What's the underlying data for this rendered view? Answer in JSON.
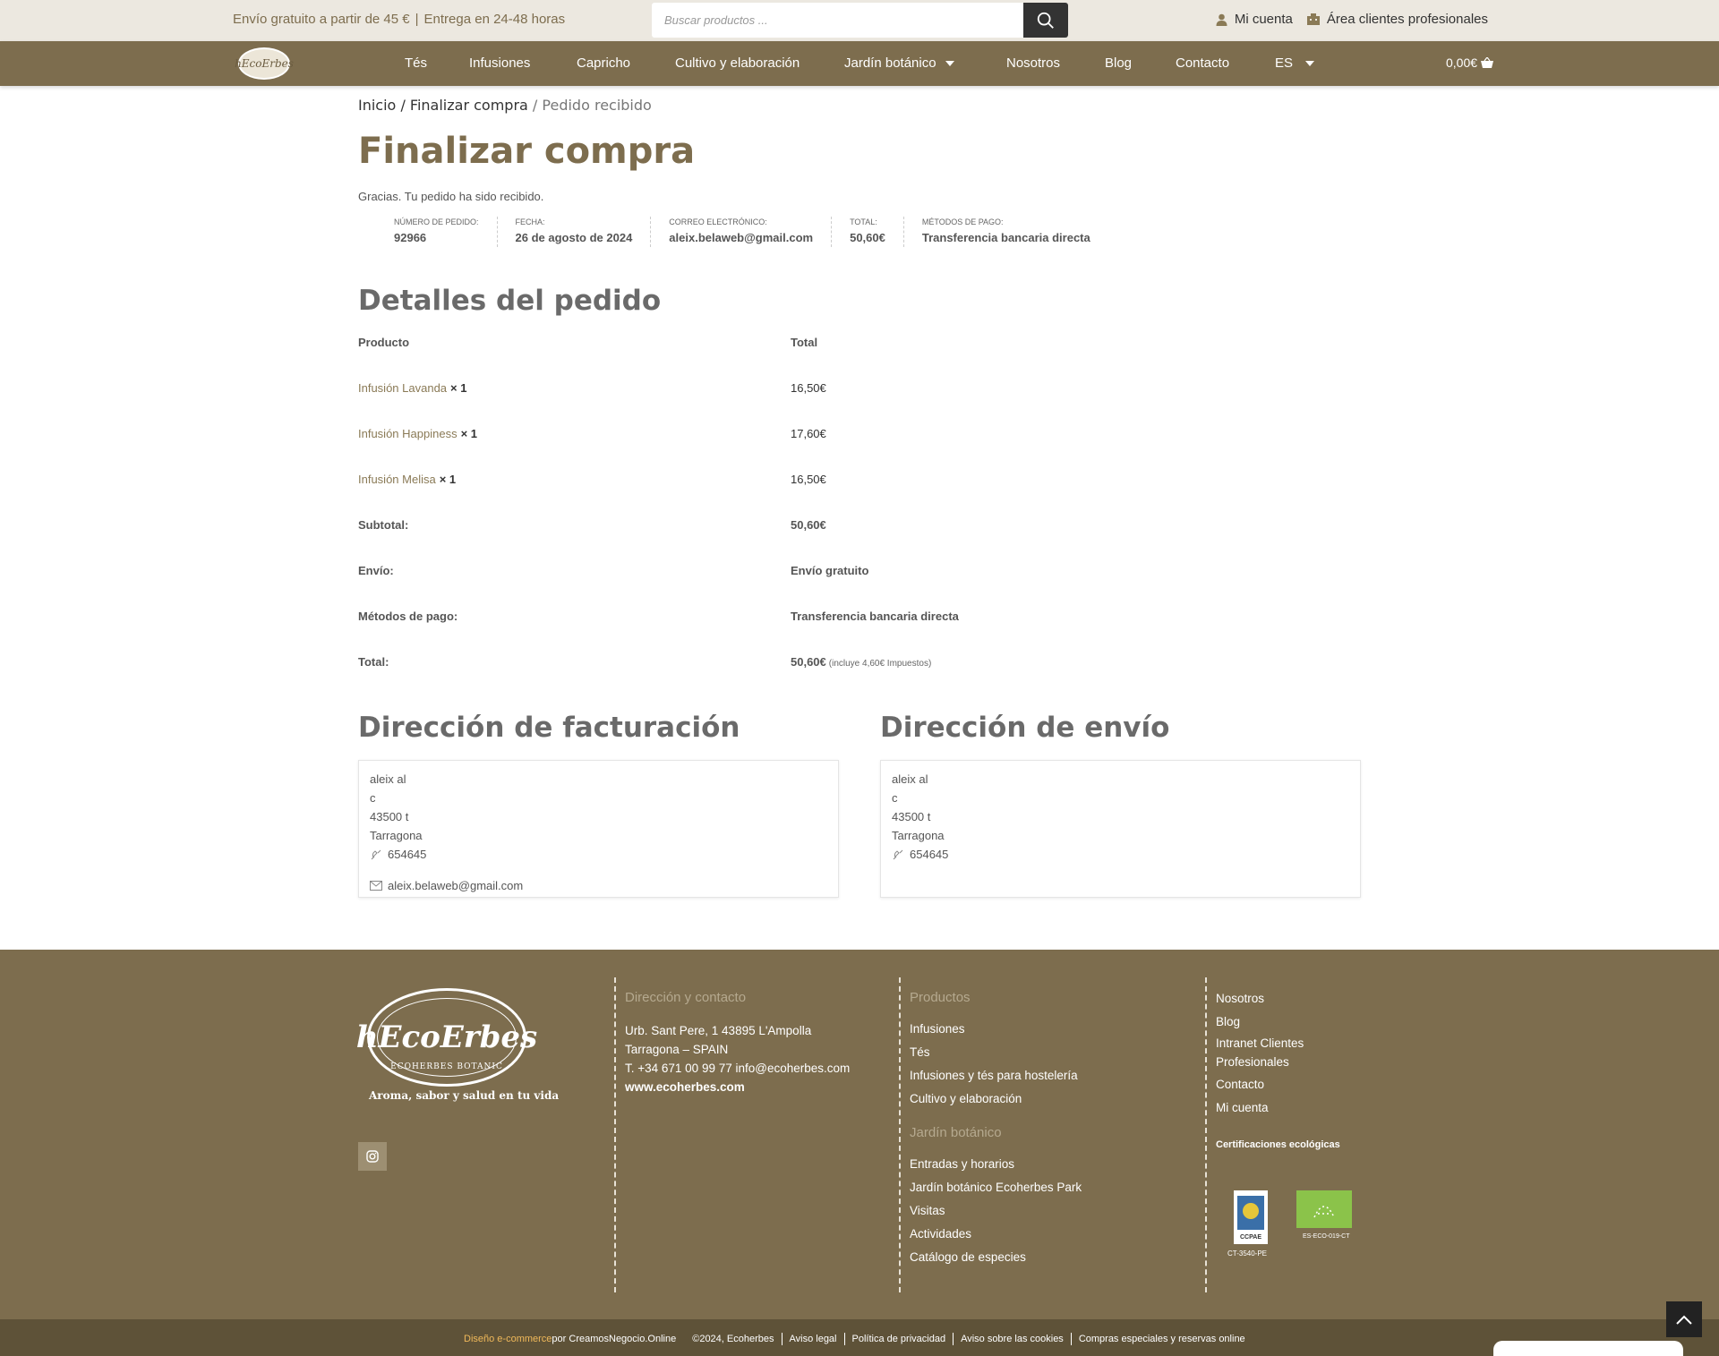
{
  "topbar": {
    "promo_shipping": "Envío gratuito a partir de 45 €",
    "promo_separator": "|",
    "promo_delivery": "Entrega en 24-48 horas",
    "search_placeholder": "Buscar productos ...",
    "my_account": "Mi cuenta",
    "pro_area": "Área clientes profesionales"
  },
  "nav": {
    "items": [
      {
        "label": "Tés"
      },
      {
        "label": "Infusiones"
      },
      {
        "label": "Capricho"
      },
      {
        "label": "Cultivo y elaboración"
      },
      {
        "label": "Jardín botánico"
      },
      {
        "label": "Nosotros"
      },
      {
        "label": "Blog"
      },
      {
        "label": "Contacto"
      },
      {
        "label": "ES"
      }
    ],
    "cart_total": "0,00€"
  },
  "breadcrumb": {
    "home": "Inicio",
    "checkout": "Finalizar compra",
    "current": "Pedido recibido",
    "sep": "/"
  },
  "page_title": "Finalizar compra",
  "thanks_message": "Gracias. Tu pedido ha sido recibido.",
  "overview": [
    {
      "label": "Número de pedido:",
      "value": "92966"
    },
    {
      "label": "Fecha:",
      "value": "26 de agosto de 2024"
    },
    {
      "label": "Correo electrónico:",
      "value": "aleix.belaweb@gmail.com"
    },
    {
      "label": "Total:",
      "value": "50,60€"
    },
    {
      "label": "Métodos de pago:",
      "value": "Transferencia bancaria directa"
    }
  ],
  "order_details": {
    "title": "Detalles del pedido",
    "col_product": "Producto",
    "col_total": "Total",
    "items": [
      {
        "name": "Infusión Lavanda",
        "qty": "× 1",
        "total": "16,50€"
      },
      {
        "name": "Infusión Happiness",
        "qty": "× 1",
        "total": "17,60€"
      },
      {
        "name": "Infusión Melisa",
        "qty": "× 1",
        "total": "16,50€"
      }
    ],
    "subtotal_label": "Subtotal:",
    "subtotal_value": "50,60€",
    "shipping_label": "Envío:",
    "shipping_value": "Envío gratuito",
    "payment_label": "Métodos de pago:",
    "payment_value": "Transferencia bancaria directa",
    "total_label": "Total:",
    "total_value": "50,60€",
    "total_tax_note": "(incluye 4,60€ Impuestos)"
  },
  "billing": {
    "title": "Dirección de facturación",
    "name": "aleix al",
    "line1": "c",
    "postcode": "43500 t",
    "city": "Tarragona",
    "phone": "654645",
    "email": "aleix.belaweb@gmail.com"
  },
  "shipping": {
    "title": "Dirección de envío",
    "name": "aleix al",
    "line1": "c",
    "postcode": "43500 t",
    "city": "Tarragona",
    "phone": "654645"
  },
  "footer": {
    "tagline": "Aroma, sabor y salud en tu vida",
    "logo_text": "hEcoErbes",
    "logo_sub": "ECOHERBES BOTANIC",
    "contact_title": "Dirección y contacto",
    "contact_address1": "Urb. Sant Pere, 1 43895 L'Ampolla",
    "contact_address2": "Tarragona – SPAIN",
    "contact_phone": "T. +34 671 00 99 77 info@ecoherbes.com",
    "contact_web": "www.ecoherbes.com",
    "products_title": "Productos",
    "products": [
      "Infusiones",
      "Tés",
      "Infusiones y tés para hostelería",
      "Cultivo y elaboración"
    ],
    "garden_title": "Jardín botánico",
    "garden": [
      "Entradas y horarios",
      "Jardín botánico Ecoherbes Park",
      "Visitas",
      "Actividades",
      "Catálogo de especies"
    ],
    "links": [
      "Nosotros",
      "Blog",
      "Intranet Clientes Profesionales",
      "Contacto",
      "Mi cuenta"
    ],
    "cert_title": "Certificaciones ecológicas",
    "cert1_caption": "CT-3540-PE",
    "cert2_caption": "ES-ECO-019-CT",
    "cert1_label": "CCPAE"
  },
  "bottombar": {
    "design_accent": "Diseño e-commerce",
    "design_by": " por CreamosNegocio.Online",
    "copyright": "©2024, Ecoherbes",
    "legal": "Aviso legal",
    "privacy": "Política de privacidad",
    "cookies": "Aviso sobre las cookies",
    "special": "Compras especiales y reservas online"
  },
  "colors": {
    "brand": "#7d6d4e",
    "topbar_bg": "#ece8e0",
    "bottombar_bg": "#5e5238",
    "accent": "#f0b95a"
  }
}
